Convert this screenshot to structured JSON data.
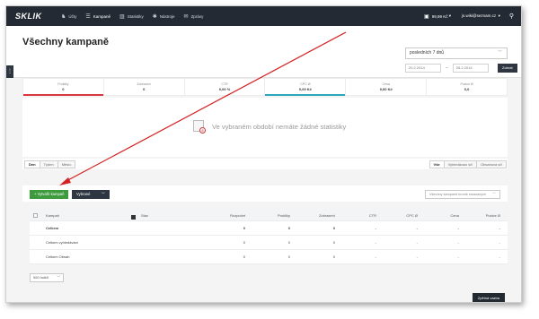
{
  "nav": {
    "logo": "SKLIK",
    "items": [
      {
        "icon": "people-icon",
        "glyph": "♞",
        "label": "Účty",
        "active": false
      },
      {
        "icon": "list-icon",
        "glyph": "☰",
        "label": "Kampaně",
        "active": true
      },
      {
        "icon": "bar-chart-icon",
        "glyph": "▥",
        "label": "Statistiky",
        "active": false
      },
      {
        "icon": "gear-icon",
        "glyph": "✱",
        "label": "Nástroje",
        "active": false
      },
      {
        "icon": "mail-icon",
        "glyph": "✉",
        "label": "Zprávy",
        "active": false
      }
    ],
    "credit": "99,99 Kč",
    "user": "js.wiki@seznam.cz"
  },
  "header": {
    "title": "Všechny kampaně",
    "period": "posledních 7 dnů",
    "date_from": "20.2.2014",
    "date_to": "26.2.2014",
    "show_button": "Zobrat"
  },
  "stats": [
    {
      "label": "Prokliky",
      "value": "0",
      "accent": "#d9363e"
    },
    {
      "label": "Zobrazení",
      "value": "0",
      "accent": ""
    },
    {
      "label": "CTR",
      "value": "0,00 %",
      "accent": ""
    },
    {
      "label": "CPC Ø",
      "value": "0,00 Kč",
      "accent": "#2aa7b8"
    },
    {
      "label": "Cena",
      "value": "0,00 Kč",
      "accent": ""
    },
    {
      "label": "Pozice Ø",
      "value": "0,0",
      "accent": ""
    }
  ],
  "chart": {
    "empty_message": "Ve vybraném období nemáte žádné statistiky"
  },
  "granularity": [
    "Den",
    "Týden",
    "Měsíc"
  ],
  "view_modes": [
    "Vše",
    "Vyhledávací síť",
    "Obsahová síť"
  ],
  "toolbar": {
    "create_label": "+ Vytvořit kampaň",
    "select_label": "Vybrané",
    "filter": "Všechny kampaně kromě smazaných"
  },
  "table": {
    "columns": [
      "Kampaň",
      "Stav",
      "Rozpočet",
      "Prokliky",
      "Zobrazení",
      "CTR",
      "CPC Ø",
      "Cena",
      "Pozice Ø"
    ],
    "rows": [
      {
        "name": "Celkem",
        "stav": "",
        "rozpocet": "0",
        "prokliky": "0",
        "zobrazeni": "0",
        "ctr": "-",
        "cpc": "-",
        "cena": "-",
        "pozice": "-"
      },
      {
        "name": "Celkem vyhledávání",
        "stav": "",
        "rozpocet": "0",
        "prokliky": "0",
        "zobrazeni": "0",
        "ctr": "-",
        "cpc": "-",
        "cena": "-",
        "pozice": "-"
      },
      {
        "name": "Celkem Obsah",
        "stav": "",
        "rozpocet": "0",
        "prokliky": "0",
        "zobrazeni": "0",
        "ctr": "-",
        "cpc": "-",
        "cena": "-",
        "pozice": "-"
      }
    ]
  },
  "per_page": "500 řádků",
  "feedback_label": "Zpětná vazba",
  "colors": {
    "nav_bg": "#232a33",
    "create_green": "#3d9a3d",
    "annotation_red": "#d42020"
  }
}
